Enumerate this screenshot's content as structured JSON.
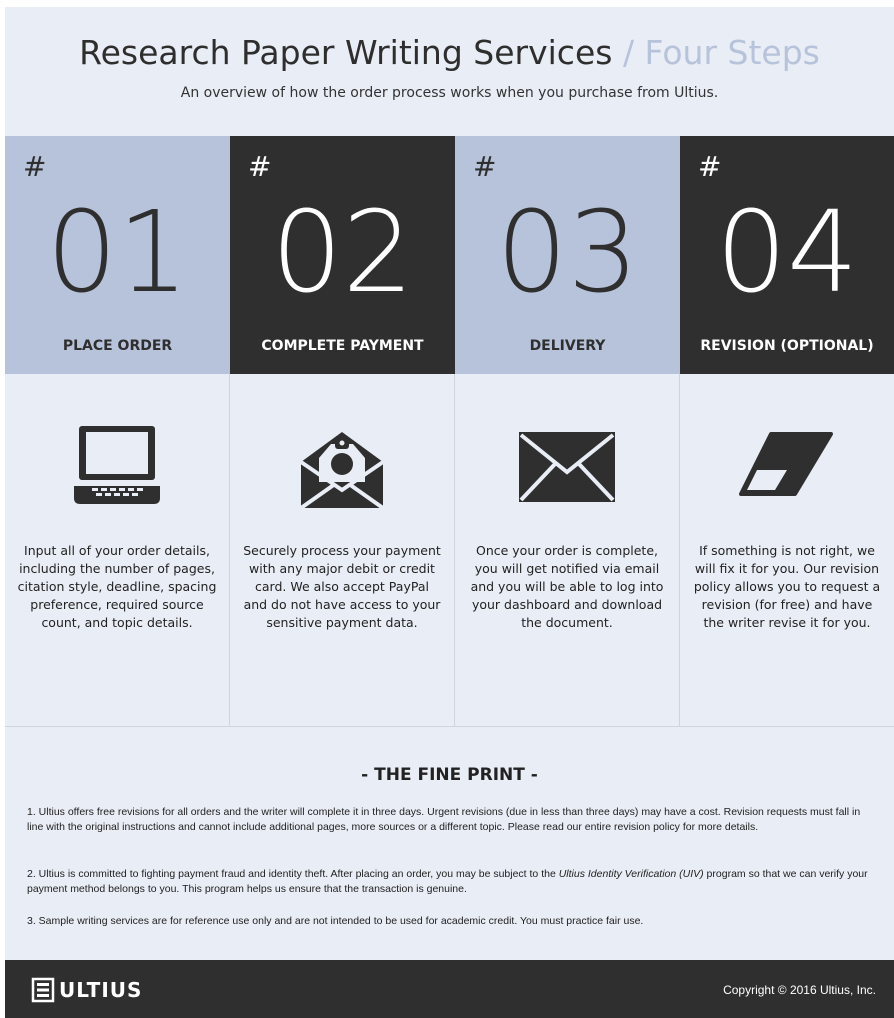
{
  "header": {
    "title_main": "Research Paper Writing Services",
    "title_accent": "/ Four Steps",
    "subtitle": "An overview of how the order process works when you purchase from Ultius."
  },
  "steps": [
    {
      "hash": "#",
      "number": "01",
      "title": "PLACE ORDER",
      "icon": "laptop-icon",
      "description": "Input all of your order details, including the number of pages, citation style, deadline, spacing preference, required source count, and topic details."
    },
    {
      "hash": "#",
      "number": "02",
      "title": "COMPLETE PAYMENT",
      "icon": "payment-envelope-icon",
      "description": "Securely process your payment with any major debit or credit card. We also accept PayPal and do not have access to your sensitive payment data."
    },
    {
      "hash": "#",
      "number": "03",
      "title": "DELIVERY",
      "icon": "envelope-icon",
      "description": "Once your order is complete, you will get notified via email and you will be able to log into your dashboard and download the document."
    },
    {
      "hash": "#",
      "number": "04",
      "title": "REVISION (OPTIONAL)",
      "icon": "eraser-icon",
      "description": "If something is not right, we will fix it for you. Our revision policy allows you to request a revision (for free) and have the writer revise it for you."
    }
  ],
  "fine_print": {
    "title": "- THE FINE PRINT -",
    "item1": "1. Ultius offers free revisions for all orders and the writer will complete it in three days. Urgent revisions (due in less than three days) may have a cost. Revision requests must fall in line with the original instructions and cannot include additional pages, more sources or a different topic. Please read our entire revision policy for more details.",
    "item2_before": "2. Ultius is committed to fighting payment fraud and identity theft. After placing an order, you may be subject to the ",
    "item2_italic": "Ultius Identity Verification (UIV)",
    "item2_after": " program so that we can verify your payment method belongs to you. This program helps us ensure that the transaction is genuine.",
    "item3": "3. Sample writing services are for reference use only and are not intended to be used for academic credit. You must practice fair use."
  },
  "footer": {
    "logo_text": "ULTIUS",
    "copyright": "Copyright © 2016 Ultius, Inc."
  },
  "colors": {
    "light_panel": "#b7c3db",
    "dark_panel": "#2f2f2f",
    "background": "#e9edf5"
  }
}
